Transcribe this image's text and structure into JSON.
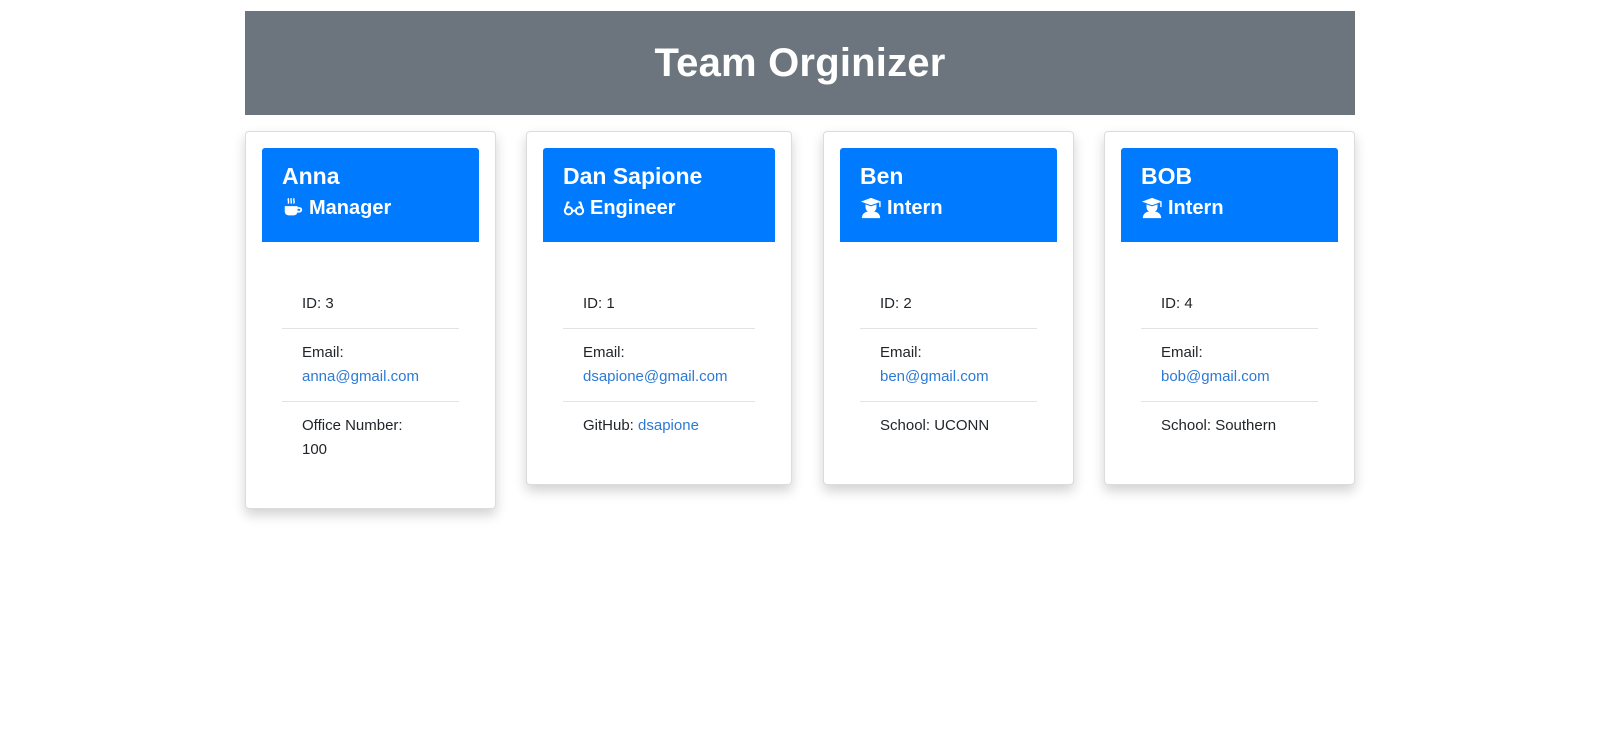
{
  "header": {
    "title": "Team Orginizer"
  },
  "cards": [
    {
      "name": "Anna",
      "role": "Manager",
      "icon": "mug-icon",
      "id_text": "ID: 3",
      "email_label": "Email:",
      "email": "anna@gmail.com",
      "extra_label": "Office Number:",
      "extra_value": "100"
    },
    {
      "name": "Dan Sapione",
      "role": "Engineer",
      "icon": "glasses-icon",
      "id_text": "ID: 1",
      "email_label": "Email:",
      "email": "dsapione@gmail.com",
      "extra_label": "GitHub:",
      "extra_value": "dsapione"
    },
    {
      "name": "Ben",
      "role": "Intern",
      "icon": "graduate-icon",
      "id_text": "ID: 2",
      "email_label": "Email:",
      "email": "ben@gmail.com",
      "extra_label": "School: UCONN"
    },
    {
      "name": "BOB",
      "role": "Intern",
      "icon": "graduate-icon",
      "id_text": "ID: 4",
      "email_label": "Email:",
      "email": "bob@gmail.com",
      "extra_label": "School: Southern"
    }
  ],
  "colors": {
    "header_bg": "#6c757d",
    "card_header_bg": "#007bff",
    "link": "#2c7ad6"
  }
}
